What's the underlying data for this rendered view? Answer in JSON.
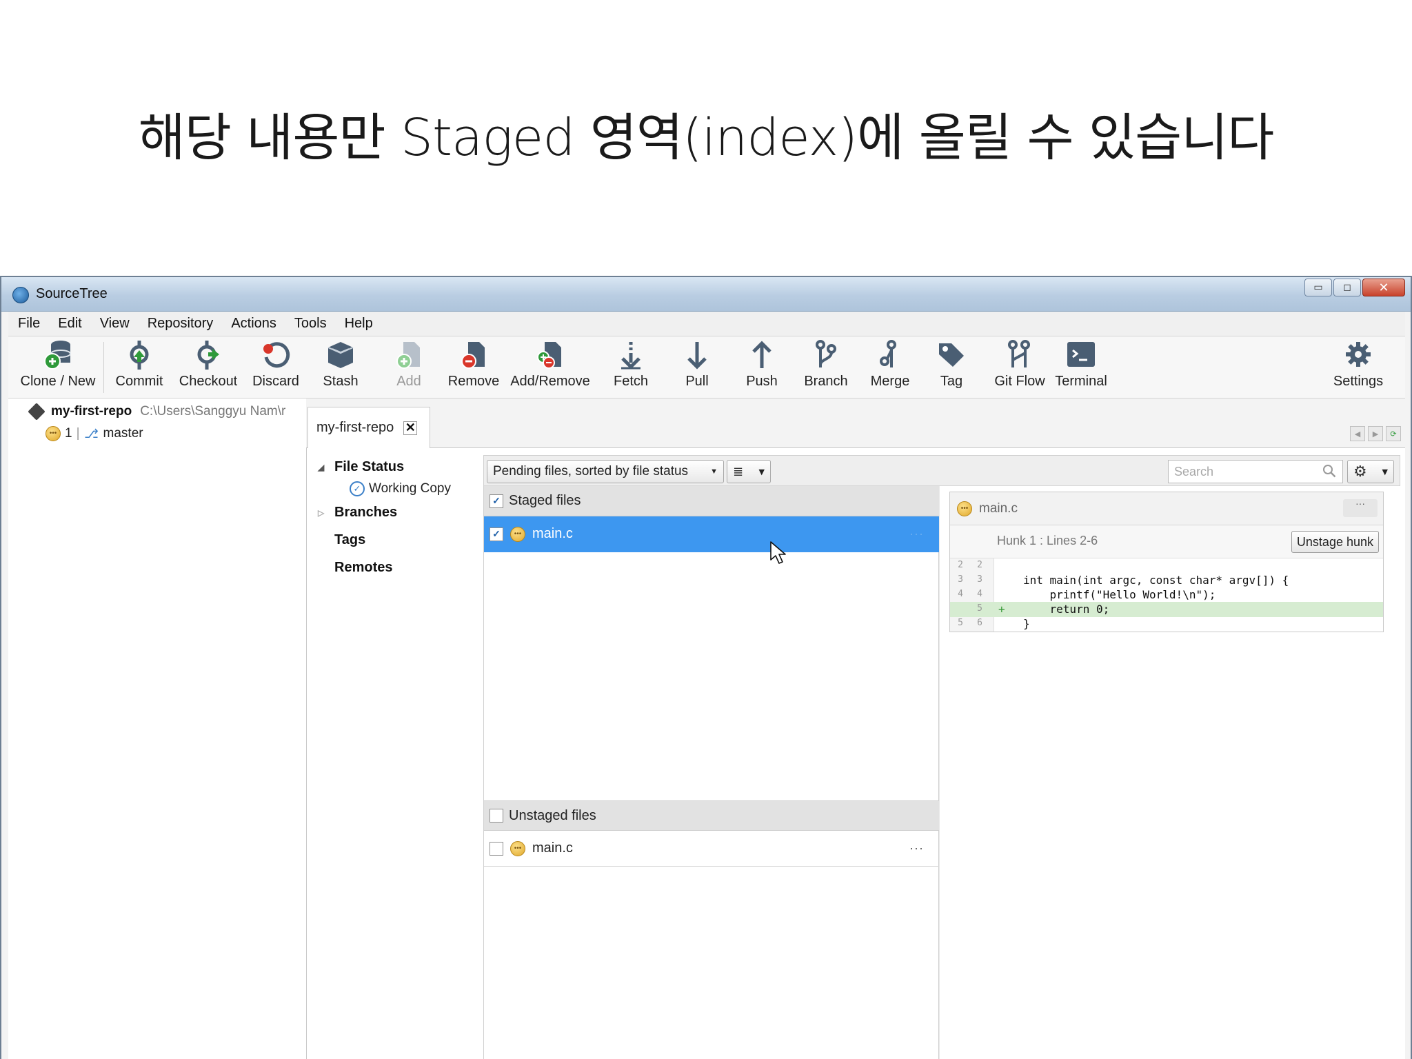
{
  "slide": {
    "caption": "해당 내용만 Staged 영역(index)에 올릴 수 있습니다"
  },
  "window": {
    "title": "SourceTree",
    "controls": {
      "minimize": "▭",
      "maximize": "◻",
      "close": "✕"
    }
  },
  "menu": [
    "File",
    "Edit",
    "View",
    "Repository",
    "Actions",
    "Tools",
    "Help"
  ],
  "toolbar": {
    "clone": "Clone / New",
    "commit": "Commit",
    "checkout": "Checkout",
    "discard": "Discard",
    "stash": "Stash",
    "add": "Add",
    "remove": "Remove",
    "addremove": "Add/Remove",
    "fetch": "Fetch",
    "pull": "Pull",
    "push": "Push",
    "branch": "Branch",
    "merge": "Merge",
    "tag": "Tag",
    "gitflow": "Git Flow",
    "terminal": "Terminal",
    "settings": "Settings"
  },
  "sidebar": {
    "repo_name": "my-first-repo",
    "repo_path": "C:\\Users\\Sanggyu Nam\\r",
    "pending_count": "1",
    "separator": "|",
    "branch": "master"
  },
  "tabs": {
    "active_tab": "my-first-repo",
    "close_glyph": "✕"
  },
  "nav": {
    "file_status": "File Status",
    "working_copy": "Working Copy",
    "branches": "Branches",
    "tags": "Tags",
    "remotes": "Remotes"
  },
  "filter": {
    "sort_label": "Pending files, sorted by file status",
    "view_glyph": "≣",
    "search_placeholder": "Search"
  },
  "staged": {
    "header": "Staged files",
    "header_checked": true,
    "files": [
      {
        "name": "main.c",
        "checked": true,
        "selected": true,
        "more": "···"
      }
    ]
  },
  "unstaged": {
    "header": "Unstaged files",
    "header_checked": false,
    "files": [
      {
        "name": "main.c",
        "checked": false,
        "selected": false,
        "more": "···"
      }
    ]
  },
  "diff": {
    "file_name": "main.c",
    "dots": "···",
    "hunk_label": "Hunk 1 : Lines 2-6",
    "unstage_button": "Unstage hunk",
    "lines": [
      {
        "old": "2",
        "new": "2",
        "marker": "",
        "text": "",
        "added": false
      },
      {
        "old": "3",
        "new": "3",
        "marker": "",
        "text": "int main(int argc, const char* argv[]) {",
        "added": false
      },
      {
        "old": "4",
        "new": "4",
        "marker": "",
        "text": "    printf(\"Hello World!\\n\");",
        "added": false
      },
      {
        "old": "",
        "new": "5",
        "marker": "+",
        "text": "    return 0;",
        "added": true
      },
      {
        "old": "5",
        "new": "6",
        "marker": "",
        "text": "}",
        "added": false
      }
    ]
  },
  "colors": {
    "selection": "#3d97f0",
    "added_line": "#d6ecd1",
    "accent_blue": "#3a7fc8",
    "modified_yellow": "#e0a82a"
  }
}
